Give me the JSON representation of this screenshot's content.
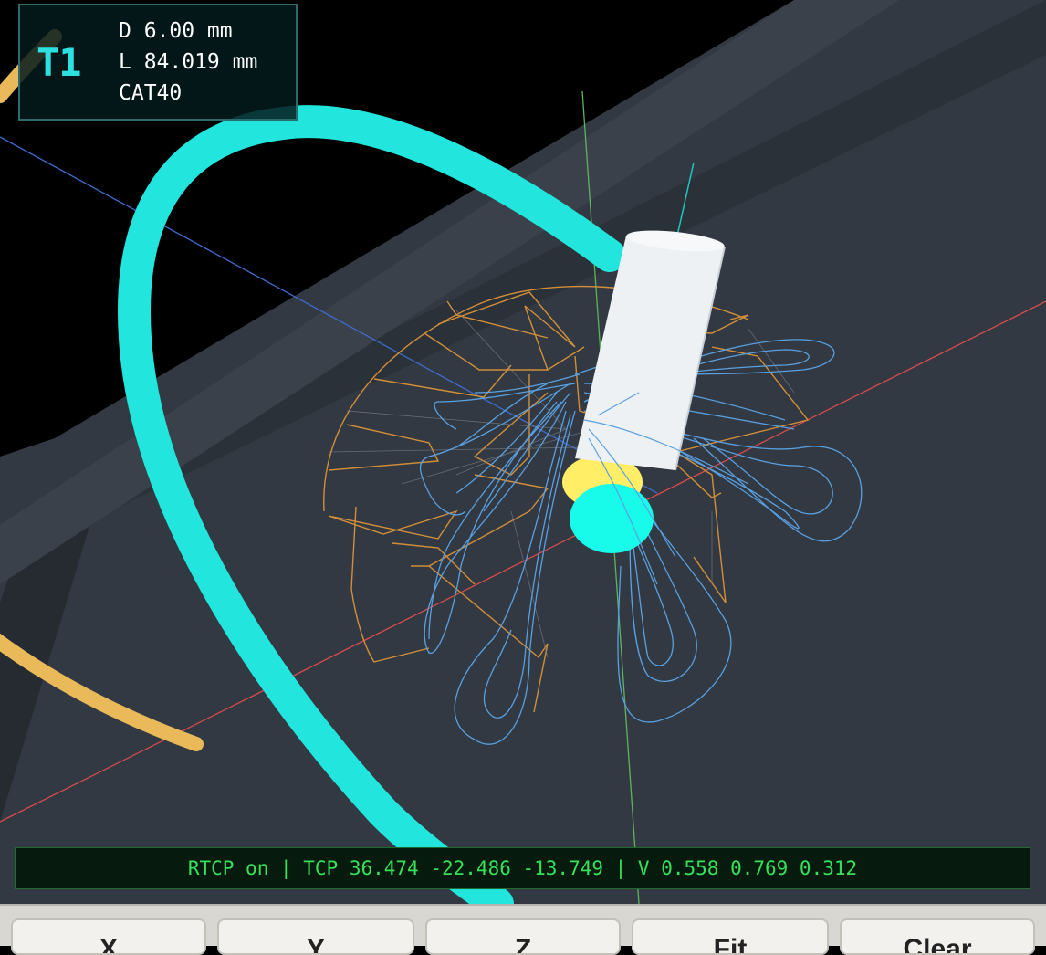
{
  "tool": {
    "number": "T1",
    "diameter": "D 6.00 mm",
    "length": "L 84.019 mm",
    "holder": "CAT40"
  },
  "status": {
    "text": "RTCP on | TCP 36.474 -22.486 -13.749 | V 0.558 0.769 0.312"
  },
  "toolbar": {
    "buttons": [
      {
        "name": "x-view-button",
        "label": "X"
      },
      {
        "name": "y-view-button",
        "label": "Y"
      },
      {
        "name": "z-view-button",
        "label": "Z"
      },
      {
        "name": "fit-button",
        "label": "Fit"
      },
      {
        "name": "clear-button",
        "label": "Clear"
      }
    ]
  },
  "colors": {
    "background": "#000000",
    "floor": "#333a43",
    "rotary_arc": "#22e5dd",
    "secondary_arc": "#e9b95a",
    "toolpath": "#5aa0e0",
    "fixture_wireframe": "#d28f3a",
    "tool_body": "#eef1f4",
    "tool_holder": "#ffee66",
    "tcp_marker": "#19fbea",
    "x_axis": "#d94c4c",
    "y_axis": "#3f6bcc",
    "z_axis": "#5fb35f"
  }
}
